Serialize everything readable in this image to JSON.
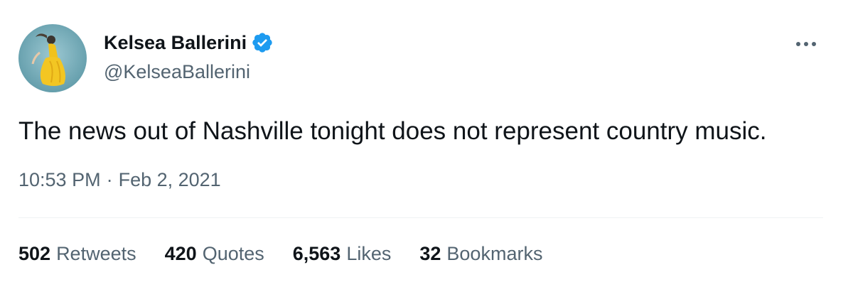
{
  "author": {
    "display_name": "Kelsea Ballerini",
    "handle": "@KelseaBallerini",
    "verified": true,
    "verified_color": "#1d9bf0"
  },
  "tweet": {
    "text": "The news out of Nashville tonight does not represent country music.",
    "time": "10:53 PM",
    "separator": "·",
    "date": "Feb 2, 2021"
  },
  "stats": [
    {
      "count": "502",
      "label": "Retweets"
    },
    {
      "count": "420",
      "label": "Quotes"
    },
    {
      "count": "6,563",
      "label": "Likes"
    },
    {
      "count": "32",
      "label": "Bookmarks"
    }
  ],
  "icons": {
    "more": "more-horizontal-icon",
    "verified": "verified-badge-icon"
  }
}
